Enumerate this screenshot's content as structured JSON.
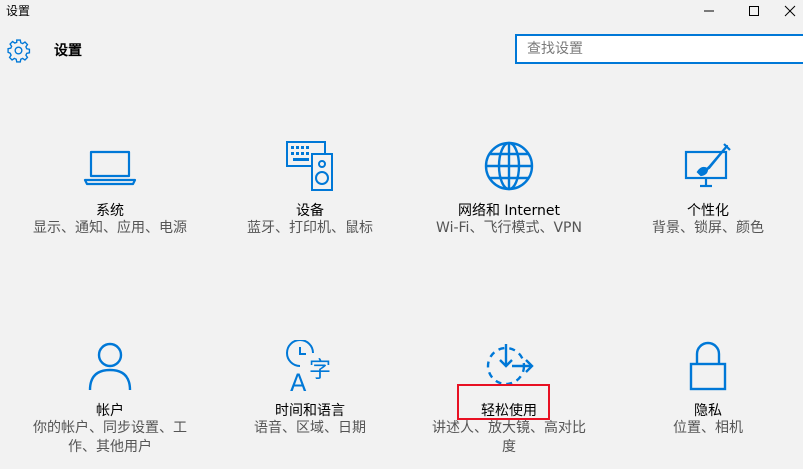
{
  "window": {
    "title": "设置",
    "controls": {
      "minimize_icon": "minimize-icon",
      "maximize_icon": "maximize-icon",
      "close_icon": "close-icon"
    }
  },
  "header": {
    "icon": "gear-icon",
    "title": "设置",
    "accent_color": "#0078d7"
  },
  "search": {
    "placeholder": "查找设置",
    "value": ""
  },
  "categories": [
    {
      "label": "系统",
      "desc": "显示、通知、应用、电源",
      "icon": "laptop-icon"
    },
    {
      "label": "设备",
      "desc": "蓝牙、打印机、鼠标",
      "icon": "devices-icon"
    },
    {
      "label": "网络和 Internet",
      "desc": "Wi-Fi、飞行模式、VPN",
      "icon": "globe-icon"
    },
    {
      "label": "个性化",
      "desc": "背景、锁屏、颜色",
      "icon": "personalization-icon"
    },
    {
      "label": "帐户",
      "desc": "你的帐户、同步设置、工作、其他用户",
      "icon": "person-icon"
    },
    {
      "label": "时间和语言",
      "desc": "语音、区域、日期",
      "icon": "time-language-icon"
    },
    {
      "label": "轻松使用",
      "desc": "讲述人、放大镜、高对比度",
      "icon": "ease-of-access-icon"
    },
    {
      "label": "隐私",
      "desc": "位置、相机",
      "icon": "lock-icon"
    }
  ],
  "highlight": {
    "target": "轻松使用",
    "color": "#e81123"
  }
}
